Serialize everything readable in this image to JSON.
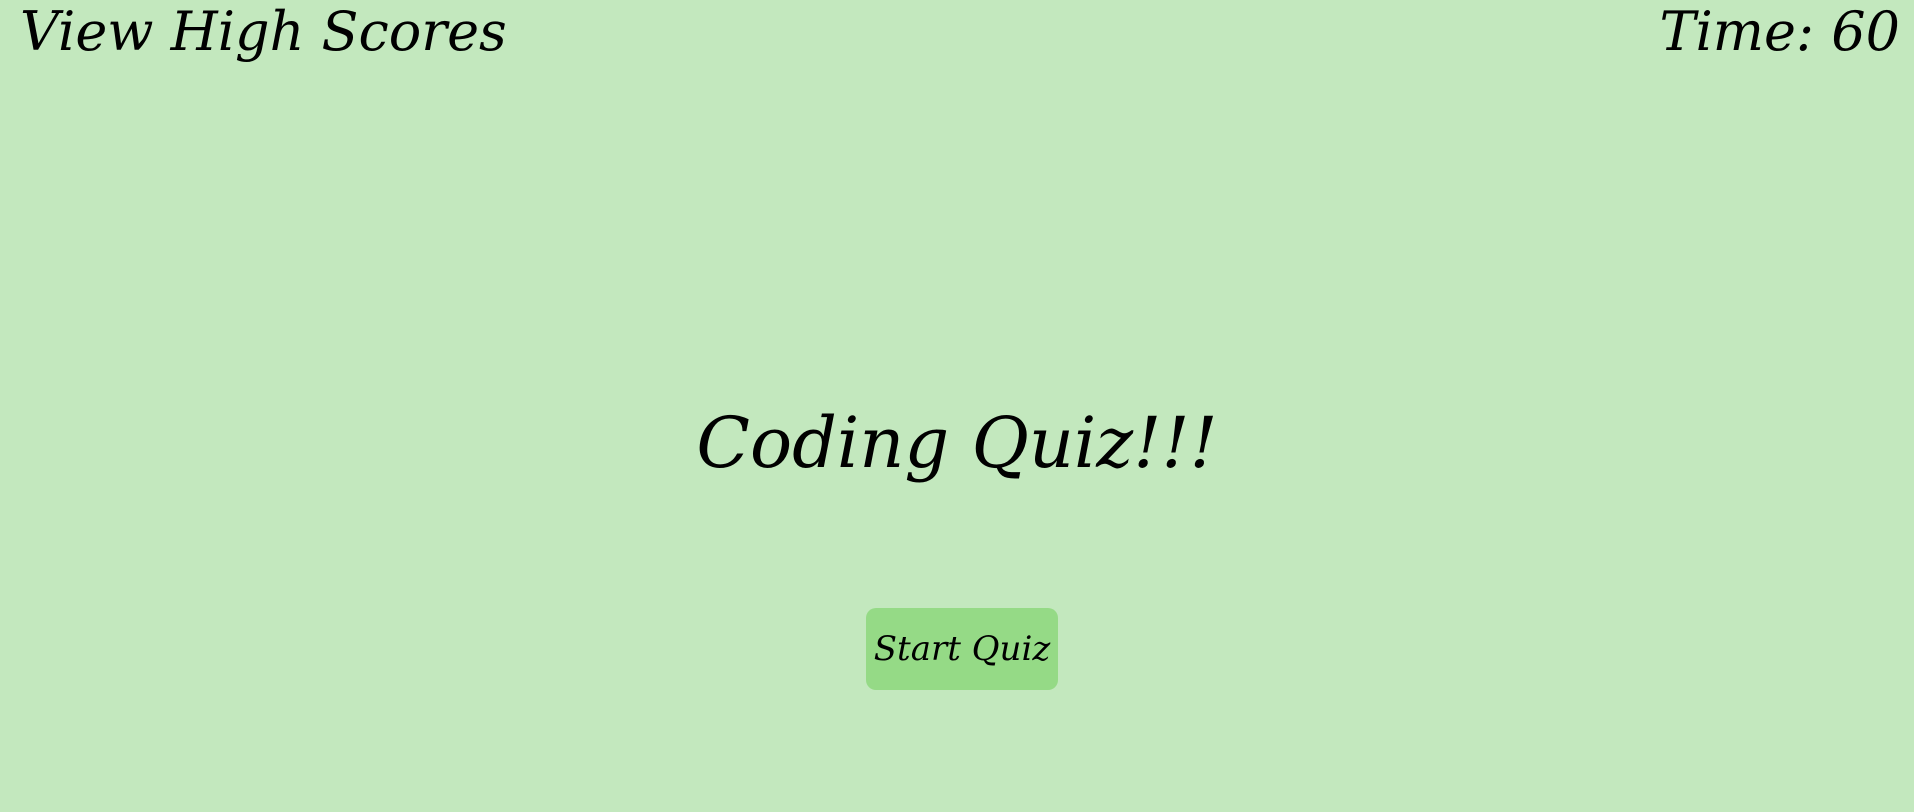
{
  "header": {
    "high_scores_label": "View High Scores",
    "timer_label": "Time: 60"
  },
  "main": {
    "title": "Coding Quiz!!!",
    "start_label": "Start Quiz"
  },
  "colors": {
    "background": "#c3e8be",
    "button": "#95da86",
    "text": "#000000"
  }
}
